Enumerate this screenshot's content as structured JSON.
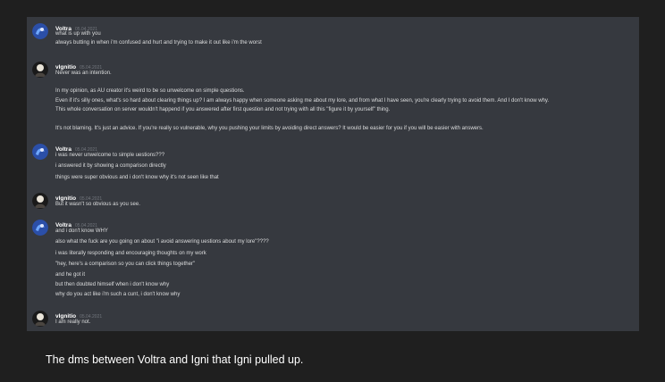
{
  "colors": {
    "page_background": "#1f1f1f",
    "chat_background": "#36393f",
    "author": "#ffffff",
    "timestamp": "#72767d",
    "text": "#dcddde",
    "caption": "#ffffff"
  },
  "messages": [
    {
      "author": "Voltra",
      "timestamp": "05.04.2021",
      "avatar": "voltra-avatar",
      "lines": [
        "what is up with you",
        "always butting in when i'm confused and hurt and trying to make it out like i'm the worst"
      ]
    },
    {
      "author": "vIgnitio",
      "timestamp": "05.04.2021",
      "avatar": "vignitio-avatar",
      "lines": [
        "Never was an intention.",
        "",
        "In my opinion, as AU creator it's weird to be so unwelcome on simple questions.",
        "Even if it's silly ones, what's so hard about clearing things up? I am always happy when someone asking me about my lore, and from what I have seen, you're clearly trying to avoid them. And I don't know why.",
        "This whole conversation on server wouldn't happend if you answered after first question and not trying with all this \"figure it by yourself\" thing.",
        "",
        "It's not blaming. It's just an advice. If you're really so vulnerable, why you pushing your limits by avoiding direct answers? It would be easier for you if you will be easier with answers."
      ]
    },
    {
      "author": "Voltra",
      "timestamp": "05.04.2021",
      "avatar": "voltra-avatar",
      "lines": [
        "i was never unwelcome to simple uestions???",
        "i answered it by showing a comparison directly",
        "things were super obvious and i don't know why it's not seen like that"
      ]
    },
    {
      "author": "vIgnitio",
      "timestamp": "05.04.2021",
      "avatar": "vignitio-avatar",
      "lines": [
        "But it wasn't so obvious as you see."
      ]
    },
    {
      "author": "Voltra",
      "timestamp": "05.04.2021",
      "avatar": "voltra-avatar",
      "lines": [
        "and i don't know WHY",
        "also what the fuck are you going on about \"i avoid answering uestions about my lore\"????",
        "i was literally responding and encouraging thoughts on my work",
        "\"hey, here's a comparison so you can click things together\"",
        "and he got it",
        "but then doubted himself when i don't know why",
        "why do you act like i'm such a cunt, i don't know why"
      ]
    },
    {
      "author": "vIgnitio",
      "timestamp": "05.04.2021",
      "avatar": "vignitio-avatar",
      "lines": [
        "I am really not."
      ]
    }
  ],
  "caption": "The dms between Voltra and Igni that Igni pulled up."
}
